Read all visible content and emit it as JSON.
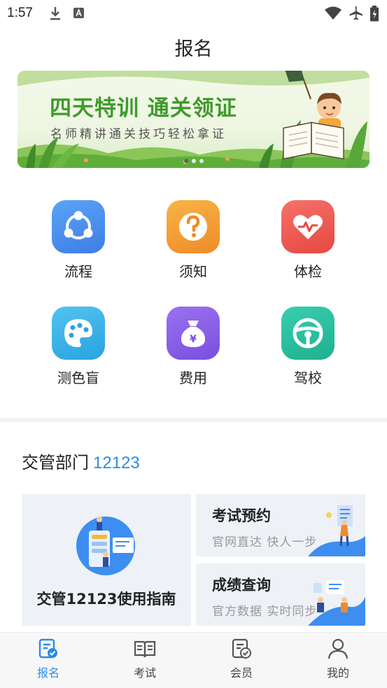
{
  "status_bar": {
    "time": "1:57"
  },
  "page": {
    "title": "报名"
  },
  "banner": {
    "headline": "四天特训 通关领证",
    "subline": "名师精讲通关技巧轻松拿证"
  },
  "grid": [
    {
      "label": "流程",
      "icon": "flow-icon",
      "color": "#4b8ff0"
    },
    {
      "label": "须知",
      "icon": "question-icon",
      "color": "#f39a2c"
    },
    {
      "label": "体检",
      "icon": "heart-icon",
      "color": "#ef5a55"
    },
    {
      "label": "测色盲",
      "icon": "palette-icon",
      "color": "#3db3e8"
    },
    {
      "label": "费用",
      "icon": "money-bag-icon",
      "color": "#8a5ee8"
    },
    {
      "label": "驾校",
      "icon": "steering-wheel-icon",
      "color": "#27bfa0"
    }
  ],
  "section": {
    "title": "交管部门",
    "number": "12123"
  },
  "cards": {
    "guide": {
      "label": "交管12123使用指南"
    },
    "exam": {
      "title": "考试预约",
      "subtitle": "官网直达 快人一步"
    },
    "score": {
      "title": "成绩查询",
      "subtitle": "官方数据 实时同步"
    }
  },
  "bottom_nav": [
    {
      "label": "报名",
      "icon": "signup-icon",
      "active": true
    },
    {
      "label": "考试",
      "icon": "book-icon",
      "active": false
    },
    {
      "label": "会员",
      "icon": "member-icon",
      "active": false
    },
    {
      "label": "我的",
      "icon": "person-icon",
      "active": false
    }
  ],
  "colors": {
    "accent": "#2a8ce6",
    "banner_green": "#3f9a2c"
  }
}
